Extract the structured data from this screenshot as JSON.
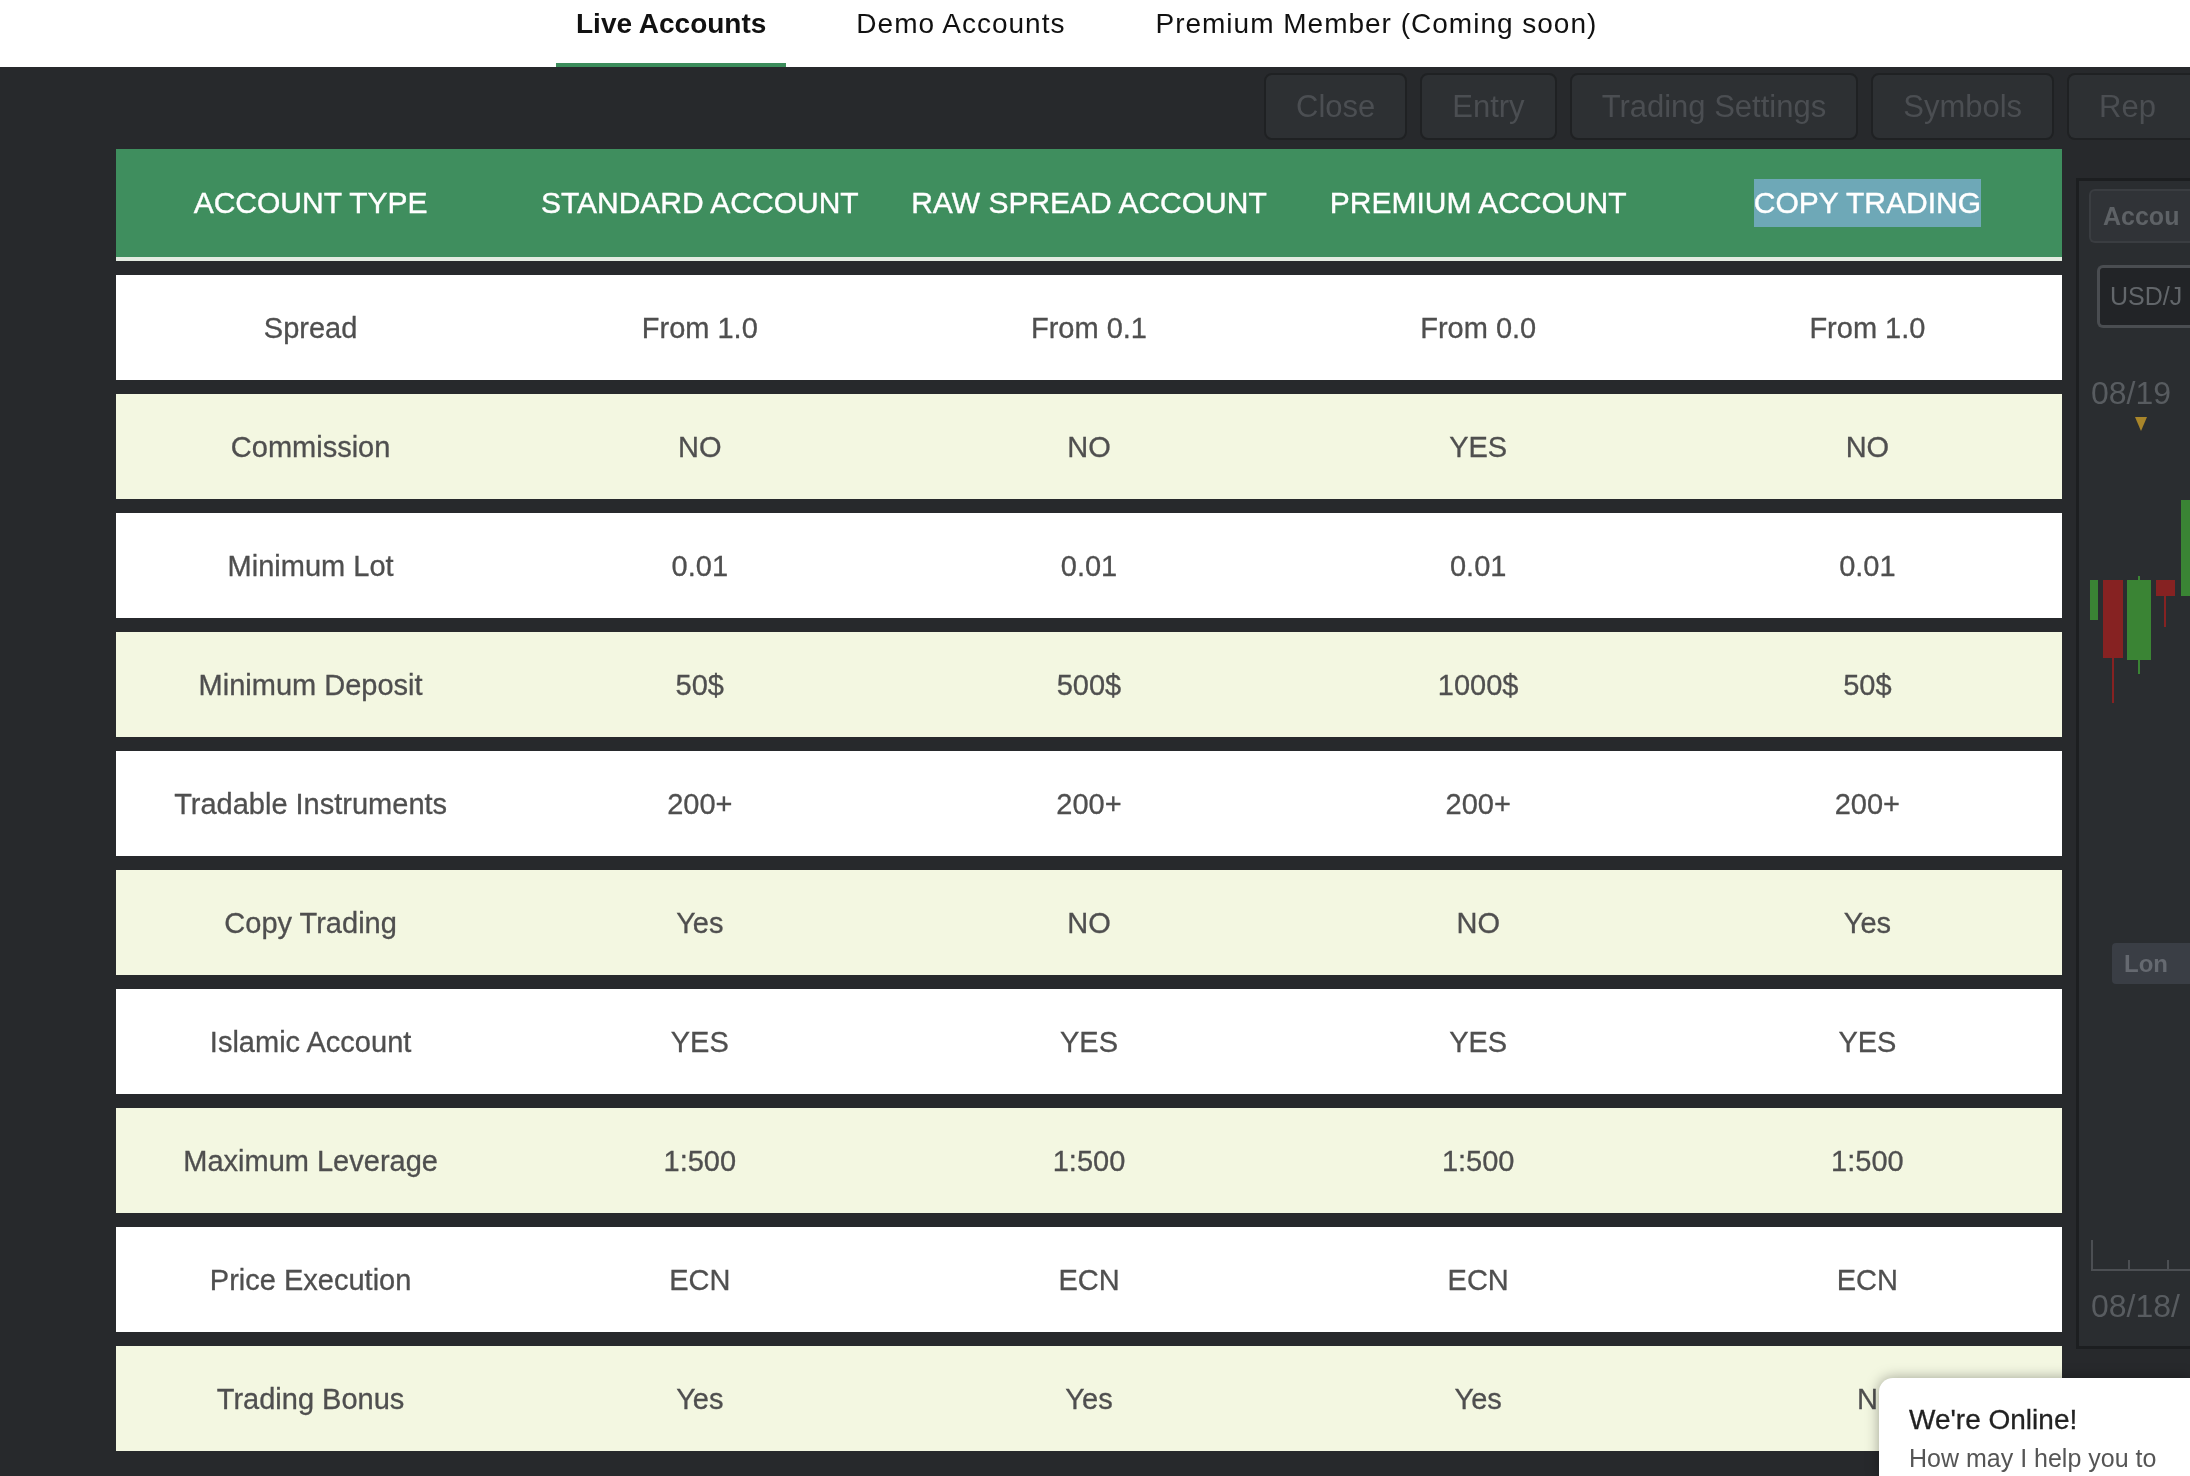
{
  "tabs": [
    {
      "label": "Live Accounts",
      "selected": true
    },
    {
      "label": "Demo Accounts",
      "selected": false
    },
    {
      "label": "Premium Member (Coming soon)",
      "selected": false
    }
  ],
  "platform_toolbar": {
    "buttons": [
      "Close",
      "Entry",
      "Trading Settings",
      "Symbols",
      "Rep"
    ]
  },
  "table": {
    "columns": [
      {
        "label": "ACCOUNT TYPE",
        "highlighted": false
      },
      {
        "label": "STANDARD ACCOUNT",
        "highlighted": false
      },
      {
        "label": "RAW SPREAD ACCOUNT",
        "highlighted": false
      },
      {
        "label": "PREMIUM ACCOUNT",
        "highlighted": false
      },
      {
        "label": "COPY TRADING",
        "highlighted": true
      }
    ],
    "rows": [
      {
        "cells": [
          "Spread",
          "From 1.0",
          "From 0.1",
          "From 0.0",
          "From 1.0"
        ]
      },
      {
        "cells": [
          "Commission",
          "NO",
          "NO",
          "YES",
          "NO"
        ]
      },
      {
        "cells": [
          "Minimum Lot",
          "0.01",
          "0.01",
          "0.01",
          "0.01"
        ]
      },
      {
        "cells": [
          "Minimum Deposit",
          "50$",
          "500$",
          "1000$",
          "50$"
        ]
      },
      {
        "cells": [
          "Tradable Instruments",
          "200+",
          "200+",
          "200+",
          "200+"
        ]
      },
      {
        "cells": [
          "Copy Trading",
          "Yes",
          "NO",
          "NO",
          "Yes"
        ]
      },
      {
        "cells": [
          "Islamic Account",
          "YES",
          "YES",
          "YES",
          "YES"
        ]
      },
      {
        "cells": [
          "Maximum Leverage",
          "1:500",
          "1:500",
          "1:500",
          "1:500"
        ]
      },
      {
        "cells": [
          "Price Execution",
          "ECN",
          "ECN",
          "ECN",
          "ECN"
        ]
      },
      {
        "cells": [
          "Trading Bonus",
          "Yes",
          "Yes",
          "Yes",
          "N"
        ]
      }
    ]
  },
  "platform_side_panel": {
    "title": "Accou",
    "symbol_field": "USD/J",
    "date_top": "08/19",
    "button": "Lon",
    "date_bottom": "08/18/"
  },
  "chat_popup": {
    "title": "We're Online!",
    "message": "How may I help you to"
  }
}
